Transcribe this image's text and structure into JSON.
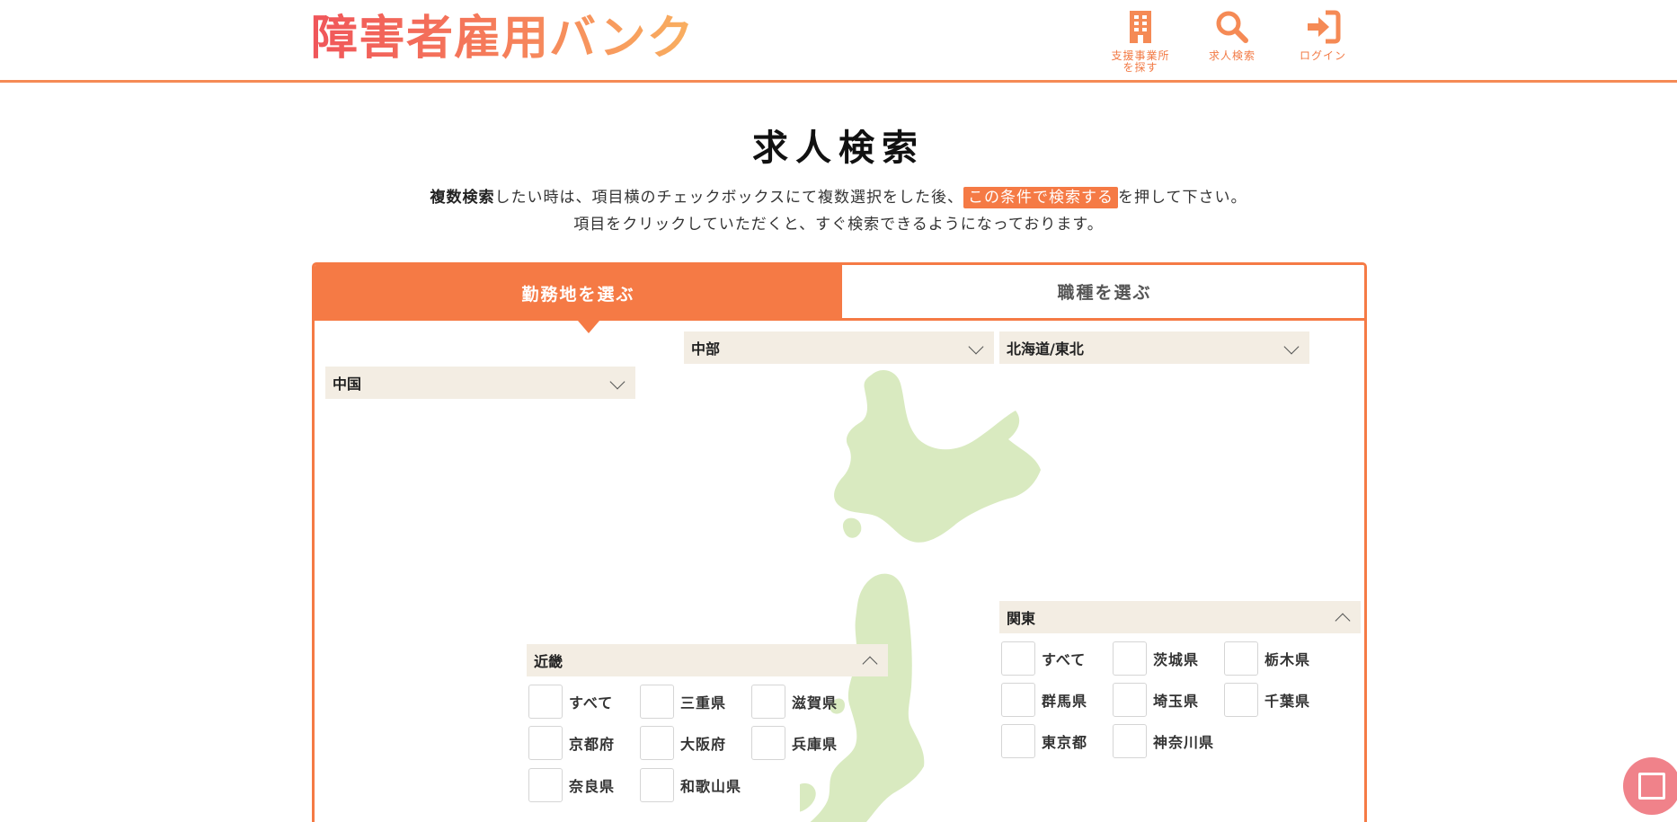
{
  "header": {
    "logo_text": "障害者雇用バンク",
    "nav": [
      {
        "label_line1": "支援事業所",
        "label_line2": "を探す",
        "icon": "building-icon"
      },
      {
        "label_line1": "求人検索",
        "label_line2": "",
        "icon": "search-icon"
      },
      {
        "label_line1": "ログイン",
        "label_line2": "",
        "icon": "login-icon"
      }
    ]
  },
  "main": {
    "title": "求人検索",
    "intro": {
      "bold": "複数検索",
      "part1": "したい時は、項目横のチェックボックスにて複数選択をした後、",
      "highlight": "この条件で検索する",
      "part2": "を押して下さい。",
      "line2": "項目をクリックしていただくと、すぐ検索できるようになっております。"
    },
    "tabs": [
      {
        "label": "勤務地を選ぶ",
        "active": true
      },
      {
        "label": "職種を選ぶ",
        "active": false
      }
    ]
  },
  "regions": {
    "chubu": {
      "label": "中部",
      "expanded": false
    },
    "hokkaido_tohoku": {
      "label": "北海道/東北",
      "expanded": false
    },
    "chugoku": {
      "label": "中国",
      "expanded": false
    },
    "kanto": {
      "label": "関東",
      "expanded": true,
      "prefs": [
        "すべて",
        "茨城県",
        "栃木県",
        "群馬県",
        "埼玉県",
        "千葉県",
        "東京都",
        "神奈川県"
      ]
    },
    "kinki": {
      "label": "近畿",
      "expanded": true,
      "prefs": [
        "すべて",
        "三重県",
        "滋賀県",
        "京都府",
        "大阪府",
        "兵庫県",
        "奈良県",
        "和歌山県"
      ]
    }
  },
  "colors": {
    "accent": "#f57a45",
    "region_bg": "#f3ede3",
    "map": "#d9eac0",
    "float_button": "#f0828a"
  }
}
